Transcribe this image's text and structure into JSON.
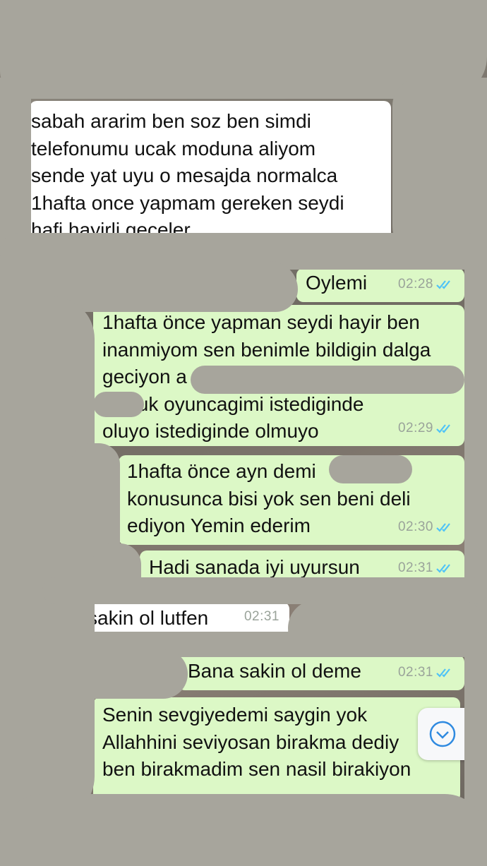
{
  "messages": [
    {
      "direction": "in",
      "text": "sabah ararim ben soz ben simdi\ntelefonumu ucak moduna aliyom\nsende yat uyu o mesajda normalca\n1hafta once yapmam gereken seydi\nhafi hayirli geceler",
      "time": ""
    },
    {
      "direction": "out",
      "text": "Oylemi",
      "time": "02:28"
    },
    {
      "direction": "out",
      "text": "1hafta önce yapman seydi hayir ben\ninanmiyom sen benimle bildigin dalga\ngeciyon a\n       Cocuk oyuncagimi istediginde\noluyo istediginde olmuyo",
      "time": "02:29"
    },
    {
      "direction": "out",
      "text": "1hafta önce ayn demi\nkonusunca bisi yok sen beni deli\nediyon Yemin ederim",
      "time": "02:30"
    },
    {
      "direction": "out",
      "text": "Hadi sanada iyi uyursun",
      "time": "02:31"
    },
    {
      "direction": "in",
      "text": "sakin ol lutfen",
      "time": "02:31"
    },
    {
      "direction": "out",
      "text": "Bana sakin ol deme",
      "time": "02:31"
    },
    {
      "direction": "out",
      "text": "Senin sevgiyedemi saygin yok\nAllahhini seviyosan birakma dediy\nben birakmadim sen nasil birakiyon",
      "time": ""
    }
  ],
  "scroll_down_icon": "chevron-down-circle-icon",
  "colors": {
    "incoming": "#ffffff",
    "outgoing": "#dcf8c6",
    "ticks": "#4fc3f7",
    "redaction": "#a7a59c"
  }
}
